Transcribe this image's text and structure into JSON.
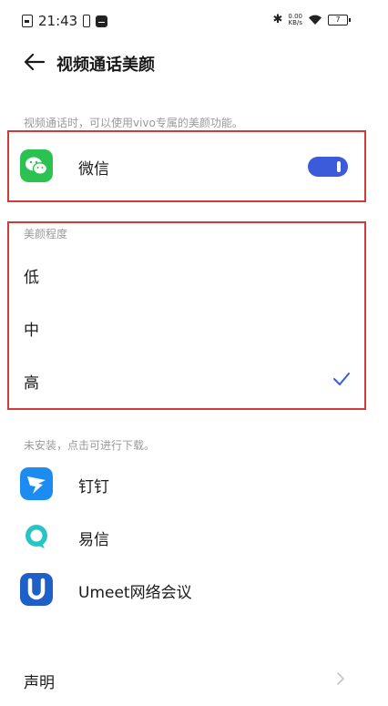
{
  "status_bar": {
    "time": "21:43",
    "net_speed_value": "0.00",
    "net_speed_unit": "KB/s",
    "battery": "7"
  },
  "header": {
    "title": "视频通话美颜"
  },
  "intro_hint": "视频通话时，可以使用vivo专属的美颜功能。",
  "installed_app": {
    "label": "微信",
    "enabled": true,
    "icon": "wechat-icon"
  },
  "beauty_level": {
    "section_label": "美颜程度",
    "options": [
      {
        "label": "低",
        "selected": false
      },
      {
        "label": "中",
        "selected": false
      },
      {
        "label": "高",
        "selected": true
      }
    ]
  },
  "not_installed": {
    "hint": "未安装，点击可进行下载。",
    "apps": [
      {
        "label": "钉钉",
        "icon": "dingtalk-icon"
      },
      {
        "label": "易信",
        "icon": "yixin-icon"
      },
      {
        "label": "Umeet网络会议",
        "icon": "umeet-icon"
      }
    ]
  },
  "declaration": {
    "label": "声明"
  },
  "colors": {
    "accent": "#3b5bdb",
    "annotation_red": "#d03a3a",
    "wechat_green": "#2bc251",
    "dingtalk_blue": "#1d8cf0",
    "yixin_teal": "#29c4c4",
    "umeet_blue": "#1f5fc8"
  }
}
